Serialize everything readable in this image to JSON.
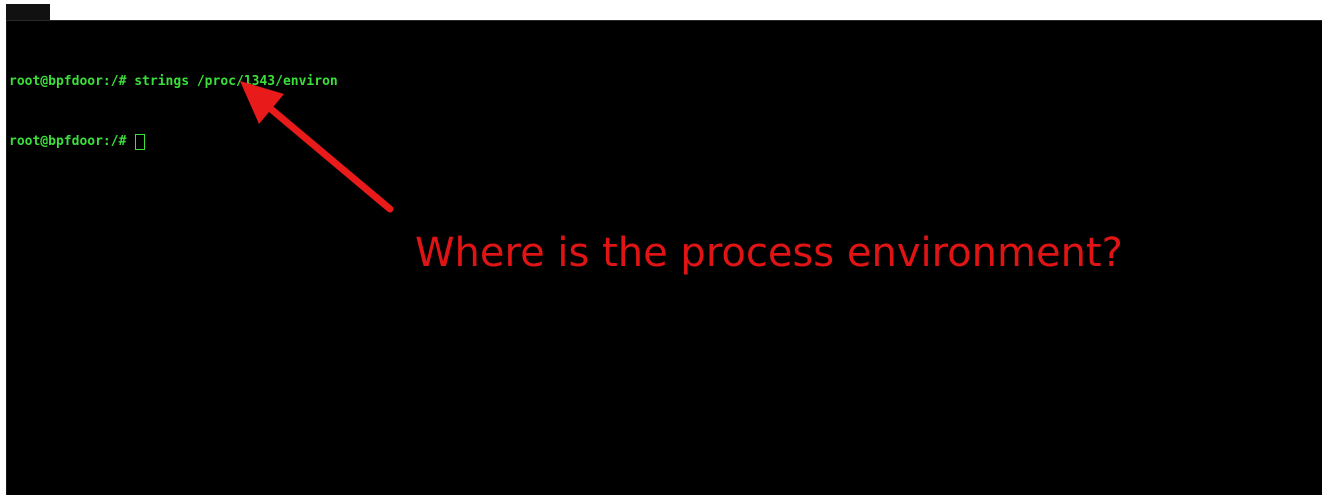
{
  "terminal": {
    "lines": [
      {
        "prompt": "root@bpfdoor:/# ",
        "command": "strings /proc/1343/environ"
      },
      {
        "prompt": "root@bpfdoor:/# ",
        "command": ""
      }
    ],
    "text_color": "#3adf3a",
    "background": "#000000"
  },
  "annotation": {
    "text": "Where is the process environment?",
    "color": "#e01414",
    "arrow_color": "#e81a1a"
  }
}
